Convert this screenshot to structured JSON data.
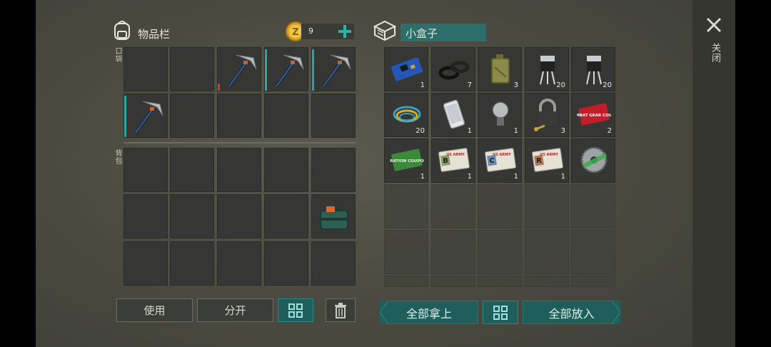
{
  "inventory": {
    "title": "物品栏",
    "coins": "9",
    "pocket_label": "口袋",
    "backpack_label": "背包"
  },
  "container": {
    "name": "小盒子",
    "items": [
      {
        "icon": "circuit-board-icon",
        "qty": "1"
      },
      {
        "icon": "rubber-rings-icon",
        "qty": "7"
      },
      {
        "icon": "jerry-can-icon",
        "qty": "3"
      },
      {
        "icon": "transistor-icon",
        "qty": "20"
      },
      {
        "icon": "transistor-icon",
        "qty": "20"
      },
      {
        "icon": "wire-coil-icon",
        "qty": "20"
      },
      {
        "icon": "smartphone-icon",
        "qty": "1"
      },
      {
        "icon": "light-bulb-icon",
        "qty": "1"
      },
      {
        "icon": "padlock-key-icon",
        "qty": "3"
      },
      {
        "icon": "combat-gear-coupon-icon",
        "qty": "2",
        "text": "COMBAT GEAR COUPON"
      },
      {
        "icon": "ration-coupon-icon",
        "qty": "1",
        "text": "RATION COUPON"
      },
      {
        "icon": "us-army-card-b-icon",
        "qty": "1",
        "text": "US ARMY",
        "letter": "B"
      },
      {
        "icon": "us-army-card-c-icon",
        "qty": "1",
        "text": "US ARMY",
        "letter": "C"
      },
      {
        "icon": "us-army-card-r-icon",
        "qty": "1",
        "text": "US ARMY",
        "letter": "R"
      },
      {
        "icon": "saw-blade-icon",
        "qty": ""
      }
    ]
  },
  "buttons": {
    "use": "使用",
    "split": "分开",
    "take_all": "全部拿上",
    "put_all": "全部放入"
  },
  "close_label": "关闭"
}
